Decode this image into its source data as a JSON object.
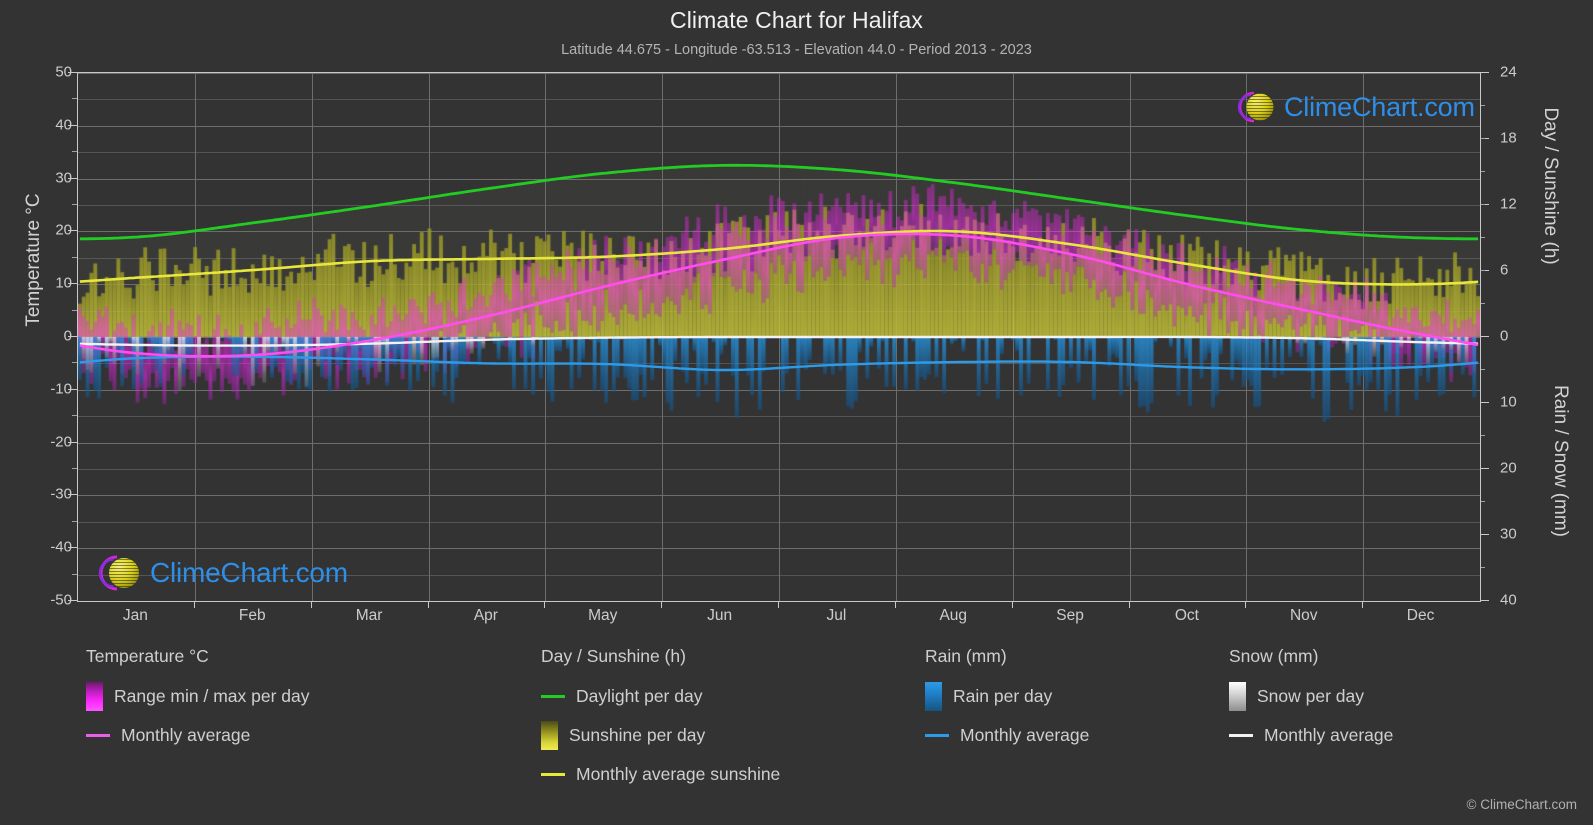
{
  "header": {
    "title": "Climate Chart for Halifax",
    "subtitle": "Latitude 44.675 - Longitude -63.513 - Elevation 44.0 - Period 2013 - 2023"
  },
  "axes": {
    "left_title": "Temperature °C",
    "right_top_title": "Day / Sunshine (h)",
    "right_bottom_title": "Rain / Snow (mm)",
    "left_ticks": [
      "50",
      "40",
      "30",
      "20",
      "10",
      "0",
      "-10",
      "-20",
      "-30",
      "-40",
      "-50"
    ],
    "right_top_ticks": [
      "24",
      "18",
      "12",
      "6",
      "0"
    ],
    "right_bottom_ticks": [
      "10",
      "20",
      "30",
      "40"
    ],
    "x_ticks": [
      "Jan",
      "Feb",
      "Mar",
      "Apr",
      "May",
      "Jun",
      "Jul",
      "Aug",
      "Sep",
      "Oct",
      "Nov",
      "Dec"
    ]
  },
  "legend": {
    "temperature": {
      "heading": "Temperature °C",
      "items": [
        {
          "label": "Range min / max per day",
          "swatch": "gradient-magenta",
          "type": "box"
        },
        {
          "label": "Monthly average",
          "swatch": "#e860e8",
          "type": "line"
        }
      ]
    },
    "daysun": {
      "heading": "Day / Sunshine (h)",
      "items": [
        {
          "label": "Daylight per day",
          "swatch": "#23cc23",
          "type": "line"
        },
        {
          "label": "Sunshine per day",
          "swatch": "gradient-yellow",
          "type": "box"
        },
        {
          "label": "Monthly average sunshine",
          "swatch": "#e8e83c",
          "type": "line"
        }
      ]
    },
    "rain": {
      "heading": "Rain (mm)",
      "items": [
        {
          "label": "Rain per day",
          "swatch": "gradient-blue",
          "type": "box"
        },
        {
          "label": "Monthly average",
          "swatch": "#2e9be8",
          "type": "line"
        }
      ]
    },
    "snow": {
      "heading": "Snow (mm)",
      "items": [
        {
          "label": "Snow per day",
          "swatch": "gradient-white",
          "type": "box"
        },
        {
          "label": "Monthly average",
          "swatch": "#f2f2f2",
          "type": "line"
        }
      ]
    }
  },
  "watermark": {
    "text": "ClimeChart.com"
  },
  "copyright": "© ClimeChart.com",
  "colors": {
    "background": "#333333",
    "grid": "#6d6d6d",
    "axis": "#c9c9c9",
    "daylight": "#23cc23",
    "sunshine": "#e8e83c",
    "temp_avg": "#ff4df0",
    "rain_avg": "#2e9be8",
    "snow_avg": "#f2f2f2",
    "logo_blue": "#2e8fe8",
    "logo_magenta": "#d426d4",
    "logo_yellow": "#d8d820"
  },
  "chart_data": {
    "type": "line",
    "title": "Climate Chart for Halifax",
    "subtitle": "Latitude 44.675 - Longitude -63.513 - Elevation 44.0 - Period 2013 - 2023",
    "xlabel": "",
    "ylabel": "Temperature °C",
    "ylim": [
      -50,
      50
    ],
    "y2lim_top": [
      0,
      24
    ],
    "y2lim_bottom": [
      0,
      40
    ],
    "grid": true,
    "legend_position": "below",
    "categories": [
      "Jan",
      "Feb",
      "Mar",
      "Apr",
      "May",
      "Jun",
      "Jul",
      "Aug",
      "Sep",
      "Oct",
      "Nov",
      "Dec"
    ],
    "series": [
      {
        "name": "Daylight per day",
        "unit": "h",
        "axis": "right-top",
        "color": "#23cc23",
        "values": [
          9.1,
          10.4,
          11.9,
          13.5,
          14.9,
          15.6,
          15.2,
          14.0,
          12.5,
          11.0,
          9.7,
          9.0
        ]
      },
      {
        "name": "Monthly average sunshine",
        "unit": "h",
        "axis": "right-top",
        "color": "#e8e83c",
        "values": [
          5.4,
          6.1,
          6.9,
          7.1,
          7.3,
          8.0,
          9.2,
          9.6,
          8.4,
          6.6,
          5.1,
          4.8
        ]
      },
      {
        "name": "Temperature monthly average",
        "unit": "°C",
        "axis": "left",
        "color": "#ff4df0",
        "values": [
          -3.1,
          -3.4,
          -0.6,
          4.0,
          9.6,
          14.6,
          18.8,
          19.2,
          15.6,
          9.9,
          5.0,
          0.4
        ]
      },
      {
        "name": "Rain monthly average",
        "unit": "mm",
        "axis": "right-bottom",
        "color": "#2e9be8",
        "values": [
          3.2,
          3.0,
          3.4,
          4.0,
          4.1,
          5.0,
          4.2,
          3.8,
          3.8,
          4.6,
          4.9,
          4.5
        ]
      },
      {
        "name": "Snow monthly average",
        "unit": "mm",
        "axis": "right-bottom",
        "color": "#f2f2f2",
        "values": [
          1.2,
          1.3,
          1.0,
          0.4,
          0.1,
          0.0,
          0.0,
          0.0,
          0.0,
          0.0,
          0.2,
          0.8
        ]
      },
      {
        "name": "Temperature range max per day",
        "unit": "°C",
        "axis": "left",
        "color": "#ff00ff",
        "values": [
          1.5,
          1.2,
          4.0,
          8.5,
          15.0,
          20.5,
          24.5,
          24.8,
          21.0,
          14.5,
          9.0,
          4.2
        ]
      },
      {
        "name": "Temperature range min per day",
        "unit": "°C",
        "axis": "left",
        "color": "#ff00ff",
        "values": [
          -7.5,
          -8.0,
          -4.8,
          -0.5,
          4.5,
          9.5,
          13.5,
          14.0,
          10.5,
          5.0,
          0.8,
          -3.2
        ]
      }
    ]
  }
}
